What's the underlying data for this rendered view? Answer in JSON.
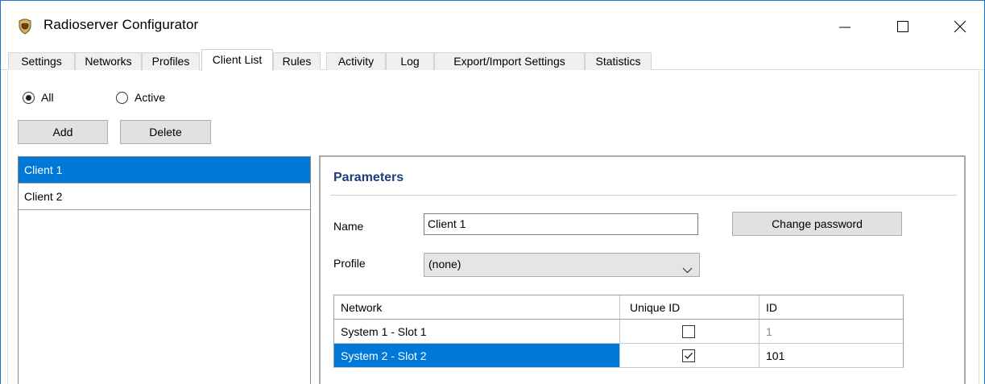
{
  "window": {
    "title": "Radioserver Configurator",
    "icon": "radioserver-app-icon",
    "controls": {
      "minimize": "minimize-icon",
      "maximize": "maximize-icon",
      "close": "close-icon"
    }
  },
  "tabs": [
    {
      "label": "Settings",
      "active": false
    },
    {
      "label": "Networks",
      "active": false
    },
    {
      "label": "Profiles",
      "active": false
    },
    {
      "label": "Client List",
      "active": true
    },
    {
      "label": "Rules",
      "active": false
    },
    {
      "label": "Activity",
      "active": false
    },
    {
      "label": "Log",
      "active": false
    },
    {
      "label": "Export/Import Settings",
      "active": false
    },
    {
      "label": "Statistics",
      "active": false
    }
  ],
  "filter": {
    "all_label": "All",
    "active_label": "Active",
    "selected": "All"
  },
  "toolbar": {
    "add_label": "Add",
    "delete_label": "Delete"
  },
  "clients": [
    {
      "label": "Client 1",
      "selected": true
    },
    {
      "label": "Client 2",
      "selected": false
    }
  ],
  "parameters": {
    "title": "Parameters",
    "name_label": "Name",
    "name_value": "Client 1",
    "change_password_label": "Change password",
    "profile_label": "Profile",
    "profile_value": "(none)",
    "grid": {
      "columns": [
        "Network",
        "Unique ID",
        "ID"
      ],
      "rows": [
        {
          "network": "System 1 - Slot 1",
          "unique_id": false,
          "id": "1",
          "selected": false
        },
        {
          "network": "System 2 - Slot 2",
          "unique_id": true,
          "id": "101",
          "selected": true
        }
      ]
    }
  },
  "colors": {
    "accent": "#0078d7",
    "section_title": "#1e3d7a",
    "window_border": "#1f73c7"
  }
}
